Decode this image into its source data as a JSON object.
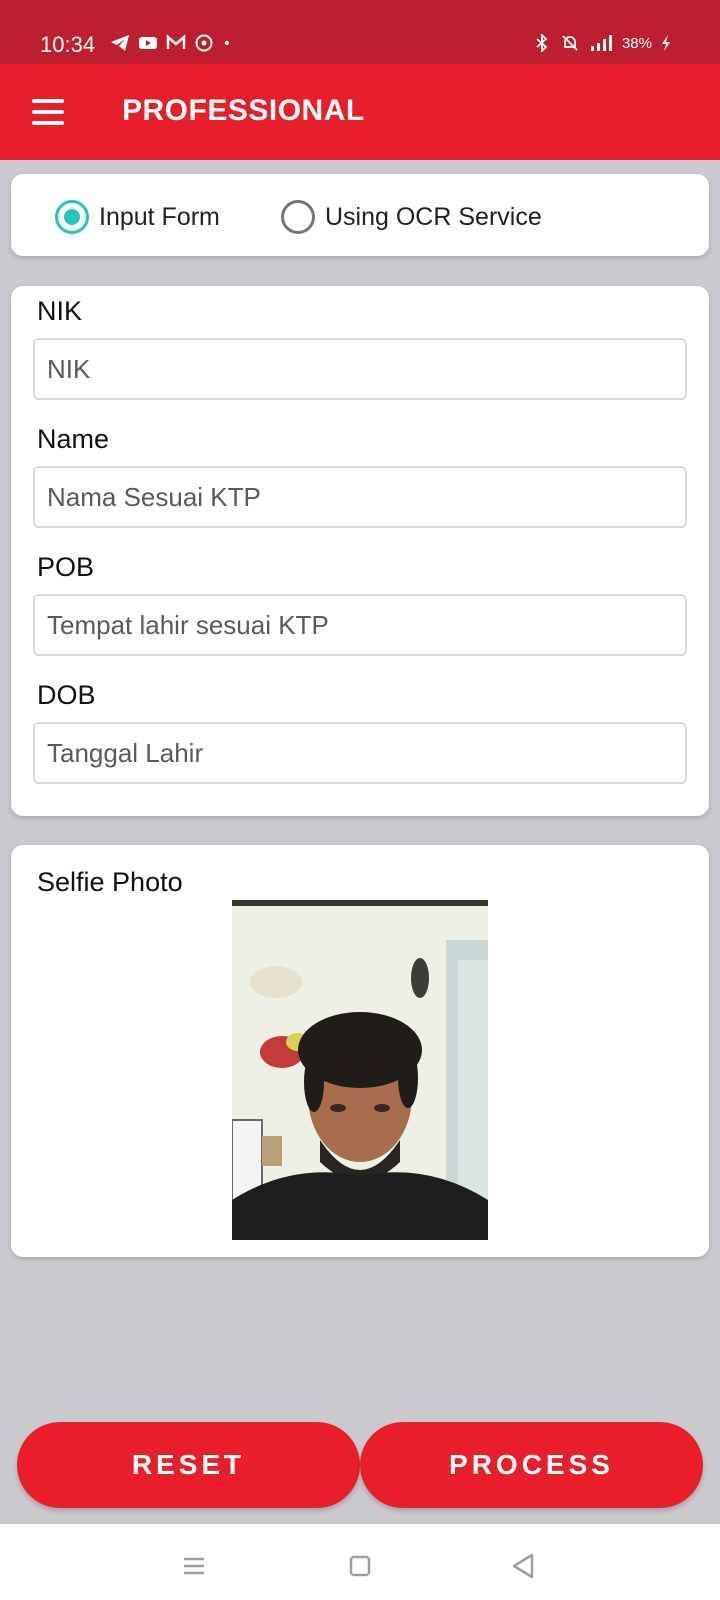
{
  "status_bar": {
    "time": "10:34",
    "battery": "38%",
    "left_icons": [
      "telegram-icon",
      "youtube-icon",
      "gmail-icon",
      "whatsapp-icon",
      "dot-icon"
    ],
    "right_icons": [
      "bluetooth-icon",
      "mute-icon",
      "signal-icon",
      "battery-charging-icon"
    ]
  },
  "app_bar": {
    "title": "PROFESSIONAL",
    "menu_icon": "menu-icon"
  },
  "input_mode": {
    "options": [
      {
        "label": "Input Form",
        "selected": true
      },
      {
        "label": "Using OCR Service",
        "selected": false
      }
    ],
    "accent_color": "#26c6b6"
  },
  "form": {
    "fields": [
      {
        "label": "NIK",
        "value": "",
        "placeholder": "NIK"
      },
      {
        "label": "Name",
        "value": "",
        "placeholder": "Nama Sesuai KTP"
      },
      {
        "label": "POB",
        "value": "",
        "placeholder": "Tempat lahir sesuai KTP"
      },
      {
        "label": "DOB",
        "value": "",
        "placeholder": "Tanggal Lahir"
      }
    ]
  },
  "selfie": {
    "label": "Selfie Photo"
  },
  "actions": {
    "reset_label": "RESET",
    "process_label": "PROCESS"
  },
  "nav_bar": {
    "icons": [
      "recent-apps-icon",
      "home-icon",
      "back-icon"
    ]
  },
  "colors": {
    "status_bar": "#bd1f30",
    "primary": "#e81f2a",
    "background": "#cbc9ce"
  }
}
